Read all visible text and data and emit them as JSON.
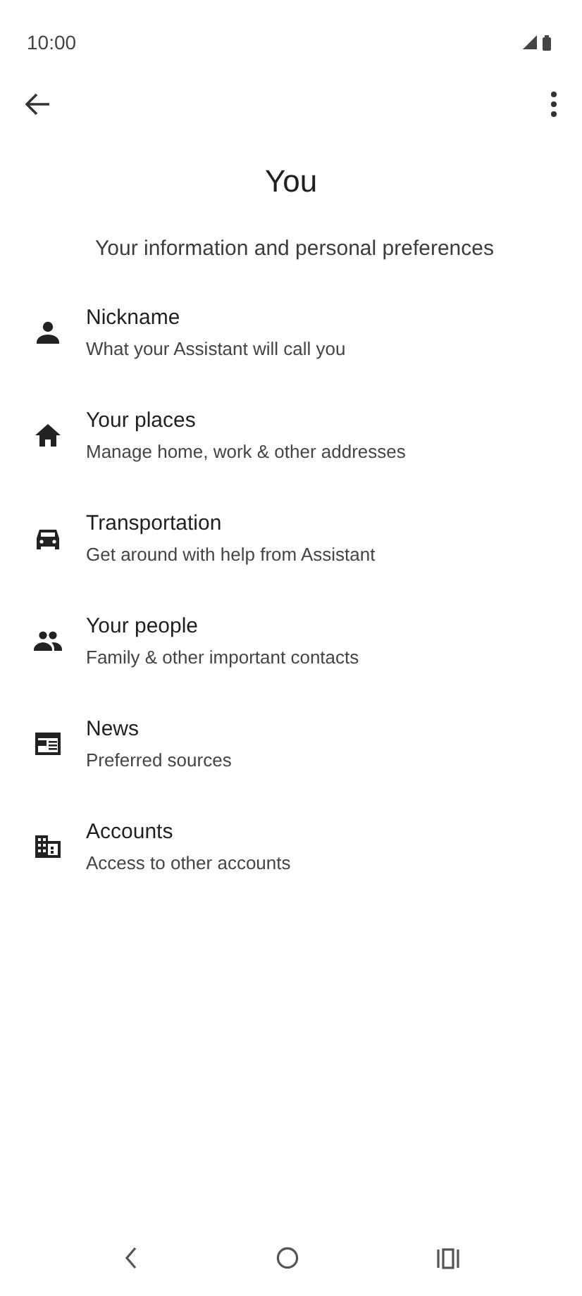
{
  "status_bar": {
    "time": "10:00"
  },
  "title": "You",
  "subtitle": "Your information and personal preferences",
  "items": [
    {
      "title": "Nickname",
      "subtitle": "What your Assistant will call you"
    },
    {
      "title": "Your places",
      "subtitle": "Manage home, work & other addresses"
    },
    {
      "title": "Transportation",
      "subtitle": "Get around with help from Assistant"
    },
    {
      "title": "Your people",
      "subtitle": "Family & other important contacts"
    },
    {
      "title": "News",
      "subtitle": "Preferred sources"
    },
    {
      "title": "Accounts",
      "subtitle": "Access to other accounts"
    }
  ]
}
